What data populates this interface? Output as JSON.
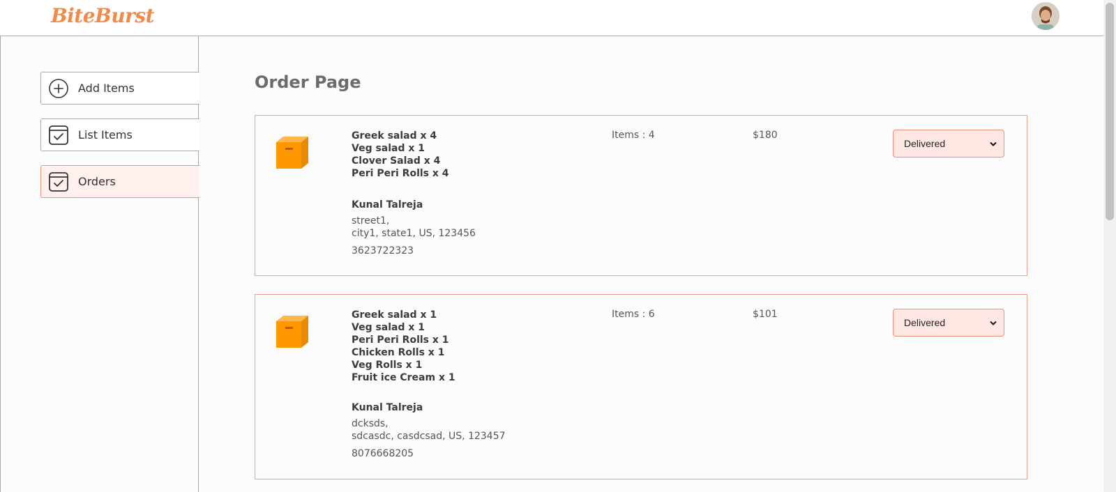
{
  "app": {
    "logo": "BiteBurst"
  },
  "sidebar": {
    "items": [
      {
        "label": "Add Items",
        "icon": "add-circle-icon"
      },
      {
        "label": "List Items",
        "icon": "checklist-icon"
      },
      {
        "label": "Orders",
        "icon": "checklist-icon"
      }
    ]
  },
  "main": {
    "title": "Order Page",
    "orders": [
      {
        "items": [
          "Greek salad x 4",
          "Veg salad x 1",
          "Clover Salad x 4",
          "Peri Peri Rolls x 4"
        ],
        "customer": "Kunal Talreja",
        "address_line1": "street1,",
        "address_line2": "city1, state1, US, 123456",
        "phone": "3623722323",
        "count": "Items : 4",
        "amount": "$180",
        "status": "Delivered"
      },
      {
        "items": [
          "Greek salad x 1",
          "Veg salad x 1",
          "Peri Peri Rolls x 1",
          "Chicken Rolls x 1",
          "Veg Rolls x 1",
          "Fruit ice Cream x 1"
        ],
        "customer": "Kunal Talreja",
        "address_line1": "dcksds,",
        "address_line2": "sdcasdc, casdcsad, US, 123457",
        "phone": "8076668205",
        "count": "Items : 6",
        "amount": "$101",
        "status": "Delivered"
      }
    ]
  },
  "colors": {
    "accent": "#f08a4b",
    "border_accent": "#f2a08b",
    "active_bg": "#fff0ed",
    "parcel": "#ff9800"
  }
}
